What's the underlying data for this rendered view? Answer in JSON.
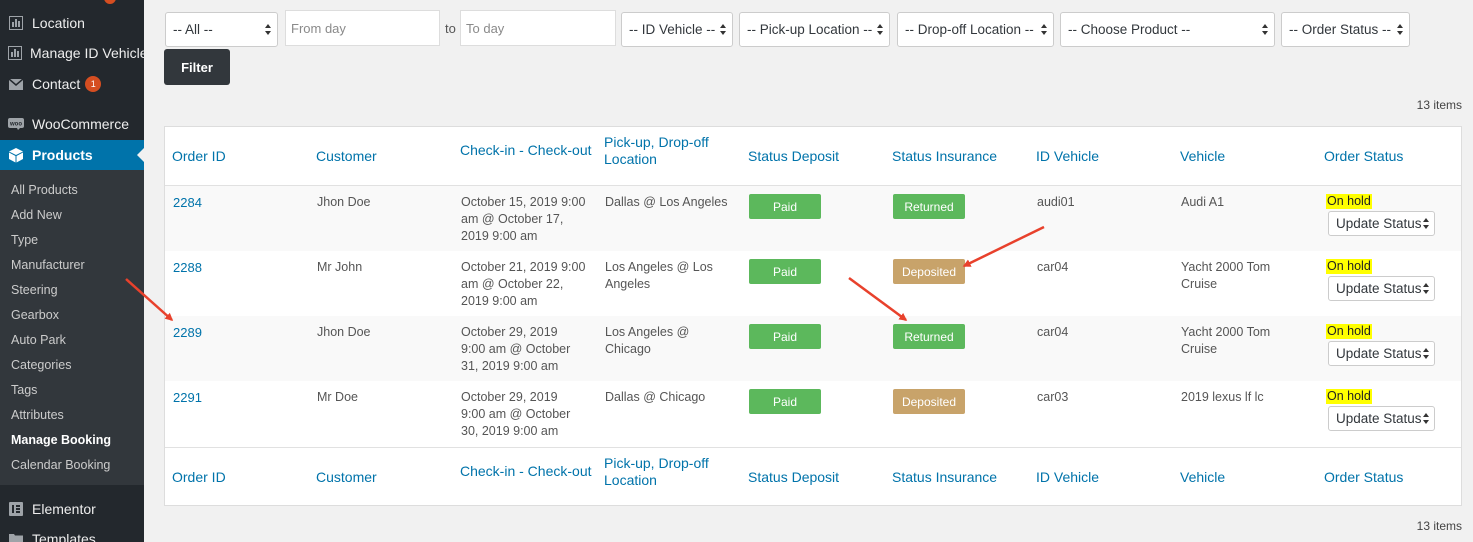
{
  "sidebar": {
    "top_items": [
      {
        "label": "Location",
        "icon": "chart-icon"
      },
      {
        "label": "Manage ID Vehicle",
        "icon": "chart-icon"
      },
      {
        "label": "Contact",
        "icon": "envelope-icon",
        "badge": "1"
      },
      {
        "label": "WooCommerce",
        "icon": "woo-icon"
      },
      {
        "label": "Products",
        "icon": "box-icon"
      }
    ],
    "submenu": [
      "All Products",
      "Add New",
      "Type",
      "Manufacturer",
      "Steering",
      "Gearbox",
      "Auto Park",
      "Categories",
      "Tags",
      "Attributes",
      "Manage Booking",
      "Calendar Booking"
    ],
    "current_submenu": "Manage Booking",
    "bottom_items": [
      {
        "label": "Elementor",
        "icon": "elementor-icon"
      },
      {
        "label": "Templates",
        "icon": "folder-icon"
      }
    ]
  },
  "filters": {
    "date_range_select": "-- All --",
    "from_placeholder": "From day",
    "to_label": "to",
    "to_placeholder": "To day",
    "vehicle_select": "-- ID Vehicle --",
    "pickup_select": "-- Pick-up Location --",
    "dropoff_select": "-- Drop-off Location --",
    "product_select": "-- Choose Product --",
    "status_select": "-- Order Status --",
    "filter_button": "Filter"
  },
  "items_count": "13 items",
  "table": {
    "columns": [
      [
        "Order ID"
      ],
      [
        "Customer"
      ],
      [
        "Check-in - Check-out"
      ],
      [
        "Pick-up, Drop-off",
        "Location"
      ],
      [
        "Status Deposit"
      ],
      [
        "Status Insurance"
      ],
      [
        "ID Vehicle"
      ],
      [
        "Vehicle"
      ],
      [
        "Order Status"
      ]
    ],
    "rows": [
      {
        "order_id": "2284",
        "customer": "Jhon Doe",
        "dates": [
          "October 15, 2019 9:00",
          "am @ October 17,",
          "2019 9:00 am"
        ],
        "locations": [
          "Dallas @ Los Angeles"
        ],
        "deposit": "Paid",
        "insurance": "Returned",
        "id_vehicle": "audi01",
        "vehicle": [
          "Audi A1"
        ],
        "order_status": "On hold",
        "update_label": "Update Status"
      },
      {
        "order_id": "2288",
        "customer": "Mr John",
        "dates": [
          "October 21, 2019 9:00",
          "am @ October 22,",
          "2019 9:00 am"
        ],
        "locations": [
          "Los Angeles @ Los",
          "Angeles"
        ],
        "deposit": "Paid",
        "insurance": "Deposited",
        "id_vehicle": "car04",
        "vehicle": [
          "Yacht 2000 Tom",
          "Cruise"
        ],
        "order_status": "On hold",
        "update_label": "Update Status"
      },
      {
        "order_id": "2289",
        "customer": "Jhon Doe",
        "dates": [
          "October 29, 2019",
          "9:00 am @ October",
          "31, 2019 9:00 am"
        ],
        "locations": [
          "Los Angeles @",
          "Chicago"
        ],
        "deposit": "Paid",
        "insurance": "Returned",
        "id_vehicle": "car04",
        "vehicle": [
          "Yacht 2000 Tom",
          "Cruise"
        ],
        "order_status": "On hold",
        "update_label": "Update Status"
      },
      {
        "order_id": "2291",
        "customer": "Mr Doe",
        "dates": [
          "October 29, 2019",
          "9:00 am @ October",
          "30, 2019 9:00 am"
        ],
        "locations": [
          "Dallas @ Chicago"
        ],
        "deposit": "Paid",
        "insurance": "Deposited",
        "id_vehicle": "car03",
        "vehicle": [
          "2019 lexus lf lc"
        ],
        "order_status": "On hold",
        "update_label": "Update Status"
      }
    ]
  },
  "colors": {
    "sidebar_bg": "#23282d",
    "submenu_bg": "#32373c",
    "active_blue": "#0073aa",
    "paid_green": "#5cb85c",
    "deposited_tan": "#c8a36a",
    "returned_green": "#5cb85c",
    "on_hold_highlight": "#ffff00",
    "arrow_red": "#e8412c"
  }
}
